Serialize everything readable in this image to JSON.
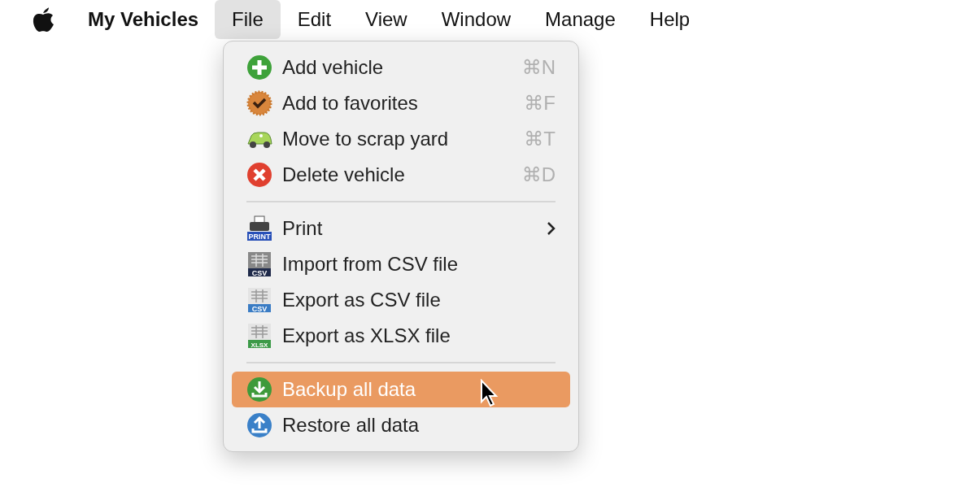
{
  "menu_bar": {
    "app_name": "My Vehicles",
    "menus": [
      {
        "label": "File",
        "selected": true
      },
      {
        "label": "Edit",
        "selected": false
      },
      {
        "label": "View",
        "selected": false
      },
      {
        "label": "Window",
        "selected": false
      },
      {
        "label": "Manage",
        "selected": false
      },
      {
        "label": "Help",
        "selected": false
      }
    ]
  },
  "file_menu": {
    "items": [
      {
        "kind": "item",
        "label": "Add vehicle",
        "shortcut": "⌘N",
        "selected": false
      },
      {
        "kind": "item",
        "label": "Add to favorites",
        "shortcut": "⌘F",
        "selected": false
      },
      {
        "kind": "item",
        "label": "Move to scrap yard",
        "shortcut": "⌘T",
        "selected": false
      },
      {
        "kind": "item",
        "label": "Delete vehicle",
        "shortcut": "⌘D",
        "selected": false
      },
      {
        "kind": "separator"
      },
      {
        "kind": "item",
        "icon_label": "PRINT",
        "label": "Print",
        "submenu": true,
        "selected": false
      },
      {
        "kind": "item",
        "icon_label": "CSV",
        "label": "Import from CSV file",
        "selected": false
      },
      {
        "kind": "item",
        "icon_label": "CSV",
        "label": "Export as CSV file",
        "selected": false
      },
      {
        "kind": "item",
        "icon_label": "XLSX",
        "label": "Export as XLSX file",
        "selected": false
      },
      {
        "kind": "separator"
      },
      {
        "kind": "item",
        "label": "Backup all data",
        "selected": true
      },
      {
        "kind": "item",
        "label": "Restore all data",
        "selected": false
      }
    ]
  }
}
